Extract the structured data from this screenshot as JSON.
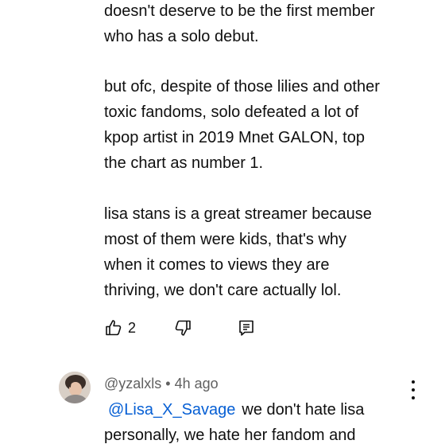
{
  "comment": {
    "lines_top": [
      "doesn't deserve to be the first member",
      "who has a solo debut."
    ],
    "lines_mid": [
      "but ofc, despite of those lilies and other",
      "toxic fandoms, solo defeated a lot of",
      "kpop artist in 2019 Mnet GALON, top",
      "the chart as number 1."
    ],
    "lines_bottom": [
      "lisa stans is a great streamer because",
      "most of them were kids, that's why",
      "when it comes to views they are",
      "thriving, we don't care actually lol."
    ],
    "actions": {
      "like_icon": "thumbs-up-icon",
      "like_count": "2",
      "dislike_icon": "thumbs-down-icon",
      "reply_icon": "reply-comment-icon"
    }
  },
  "reply_comment": {
    "author": "@yzalxls",
    "separator": "•",
    "time": "4h ago",
    "mention": "@Lisa_X_Savage",
    "line1_rest": "we don't hate lisa",
    "line2": "personally, we hate her fandom and",
    "menu_icon": "more-vert-icon"
  },
  "colors": {
    "text": "#0f0f0f",
    "secondary_text": "#606060",
    "mention": "#065fd4",
    "background": "#ffffff"
  }
}
